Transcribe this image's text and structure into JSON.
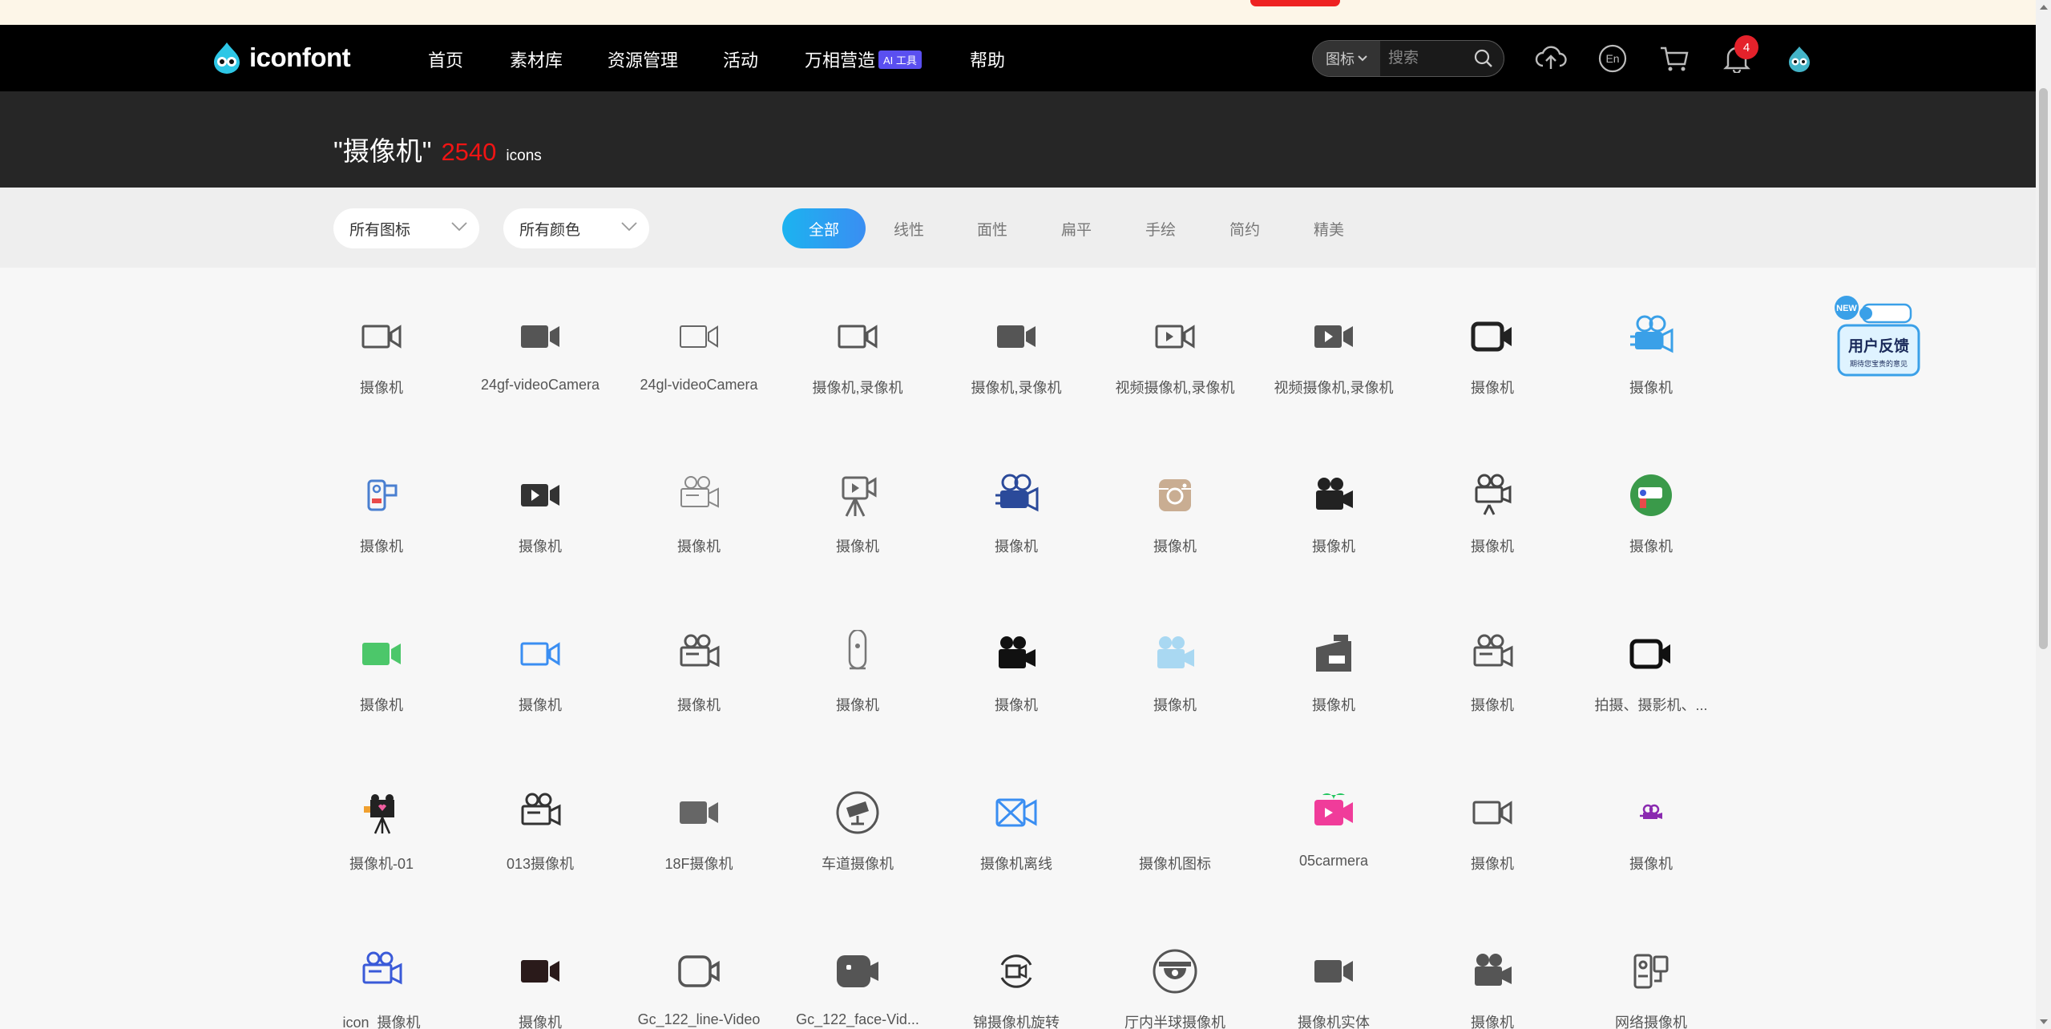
{
  "brand": {
    "name": "iconfont"
  },
  "nav": {
    "items": [
      {
        "label": "首页"
      },
      {
        "label": "素材库"
      },
      {
        "label": "资源管理"
      },
      {
        "label": "活动"
      },
      {
        "label": "万相营造",
        "badge": "AI 工具"
      },
      {
        "label": "帮助"
      }
    ],
    "search": {
      "scope": "图标",
      "placeholder": "搜索"
    },
    "notification_count": "4"
  },
  "header": {
    "query": "\"摄像机\"",
    "count": "2540",
    "unit": "icons"
  },
  "filters": {
    "type_dropdown": "所有图标",
    "color_dropdown": "所有颜色",
    "tabs": [
      {
        "label": "全部",
        "active": true
      },
      {
        "label": "线性"
      },
      {
        "label": "面性"
      },
      {
        "label": "扁平"
      },
      {
        "label": "手绘"
      },
      {
        "label": "简约"
      },
      {
        "label": "精美"
      }
    ]
  },
  "feedback": {
    "badge": "NEW",
    "title": "用户反馈",
    "subtitle": "期待您宝贵的意见"
  },
  "colors": {
    "accent_gradient_start": "#1cb3f0",
    "accent_gradient_end": "#3a8ef2",
    "count_red": "#f01414",
    "badge_purple": "#5a4ff0"
  },
  "icons": [
    {
      "label": "摄像机",
      "icon": "video-outline-icon",
      "color": "#555555"
    },
    {
      "label": "24gf-videoCamera",
      "icon": "video-solid-icon",
      "color": "#555555"
    },
    {
      "label": "24gl-videoCamera",
      "icon": "video-outline-thin-icon",
      "color": "#666666"
    },
    {
      "label": "摄像机,录像机",
      "icon": "video-outline-icon",
      "color": "#555555"
    },
    {
      "label": "摄像机,录像机",
      "icon": "video-solid-icon",
      "color": "#555555"
    },
    {
      "label": "视频摄像机,录像机",
      "icon": "video-play-outline-icon",
      "color": "#555555"
    },
    {
      "label": "视频摄像机,录像机",
      "icon": "video-play-solid-icon",
      "color": "#555555"
    },
    {
      "label": "摄像机",
      "icon": "video-bold-outline-icon",
      "color": "#222222"
    },
    {
      "label": "摄像机",
      "icon": "movie-camera-blue-icon",
      "color": "#3aa0e8"
    },
    {
      "label": "摄像机",
      "icon": "handheld-camcorder-icon",
      "color": "#4a7fd0"
    },
    {
      "label": "摄像机",
      "icon": "video-play-solid-icon",
      "color": "#333333"
    },
    {
      "label": "摄像机",
      "icon": "film-camera-light-icon",
      "color": "#888888"
    },
    {
      "label": "摄像机",
      "icon": "camera-tripod-icon",
      "color": "#666666"
    },
    {
      "label": "摄像机",
      "icon": "movie-camera-blue-icon",
      "color": "#2b4a9a"
    },
    {
      "label": "摄像机",
      "icon": "instagram-camera-icon",
      "color": "#c9ad92"
    },
    {
      "label": "摄像机",
      "icon": "movie-camera-solid-icon",
      "color": "#222222"
    },
    {
      "label": "摄像机",
      "icon": "film-camera-tripod-icon",
      "color": "#444444"
    },
    {
      "label": "摄像机",
      "icon": "security-camera-circle-icon",
      "color": "#3a9a4a"
    },
    {
      "label": "摄像机",
      "icon": "video-solid-icon",
      "color": "#4cc76a"
    },
    {
      "label": "摄像机",
      "icon": "video-outline-icon",
      "color": "#3a8ef2"
    },
    {
      "label": "摄像机",
      "icon": "film-camera-outline-icon",
      "color": "#555555"
    },
    {
      "label": "摄像机",
      "icon": "webcam-outline-icon",
      "color": "#777777"
    },
    {
      "label": "摄像机",
      "icon": "movie-camera-solid-icon",
      "color": "#111111"
    },
    {
      "label": "摄像机",
      "icon": "movie-camera-solid-icon",
      "color": "#a9d8f2"
    },
    {
      "label": "摄像机",
      "icon": "camcorder-solid-icon",
      "color": "#555555"
    },
    {
      "label": "摄像机",
      "icon": "film-camera-outline-icon",
      "color": "#555555"
    },
    {
      "label": "拍摄、摄影机、...",
      "icon": "video-bold-outline-icon",
      "color": "#111111"
    },
    {
      "label": "摄像机-01",
      "icon": "camera-tripod-pink-icon",
      "color": "#222222"
    },
    {
      "label": "013摄像机",
      "icon": "film-camera-outline-icon",
      "color": "#333333"
    },
    {
      "label": "18F摄像机",
      "icon": "video-solid-icon",
      "color": "#666666"
    },
    {
      "label": "车道摄像机",
      "icon": "cctv-circle-icon",
      "color": "#555555"
    },
    {
      "label": "摄像机离线",
      "icon": "video-offline-icon",
      "color": "#3a8ef2"
    },
    {
      "label": "摄像机图标",
      "icon": "blank-icon",
      "color": "#f7f7f7"
    },
    {
      "label": "05carmera",
      "icon": "video-play-pink-icon",
      "color": "#f03c9a"
    },
    {
      "label": "摄像机",
      "icon": "video-outline-icon",
      "color": "#555555"
    },
    {
      "label": "摄像机",
      "icon": "movie-camera-small-icon",
      "color": "#8a2ab0"
    },
    {
      "label": "icon_摄像机",
      "icon": "film-camera-outline-icon",
      "color": "#3a5ad8"
    },
    {
      "label": "摄像机",
      "icon": "video-solid-icon",
      "color": "#2a1a1a"
    },
    {
      "label": "Gc_122_line-Video",
      "icon": "video-rounded-outline-icon",
      "color": "#555555"
    },
    {
      "label": "Gc_122_face-Vid...",
      "icon": "video-rounded-solid-icon",
      "color": "#555555"
    },
    {
      "label": "锦摄像机旋转",
      "icon": "video-rotate-icon",
      "color": "#333333"
    },
    {
      "label": "厅内半球摄像机",
      "icon": "dome-camera-icon",
      "color": "#555555"
    },
    {
      "label": "摄像机实体",
      "icon": "video-solid-icon",
      "color": "#555555"
    },
    {
      "label": "摄像机",
      "icon": "movie-camera-solid-icon",
      "color": "#555555"
    },
    {
      "label": "网络摄像机",
      "icon": "network-camera-icon",
      "color": "#555555"
    }
  ]
}
